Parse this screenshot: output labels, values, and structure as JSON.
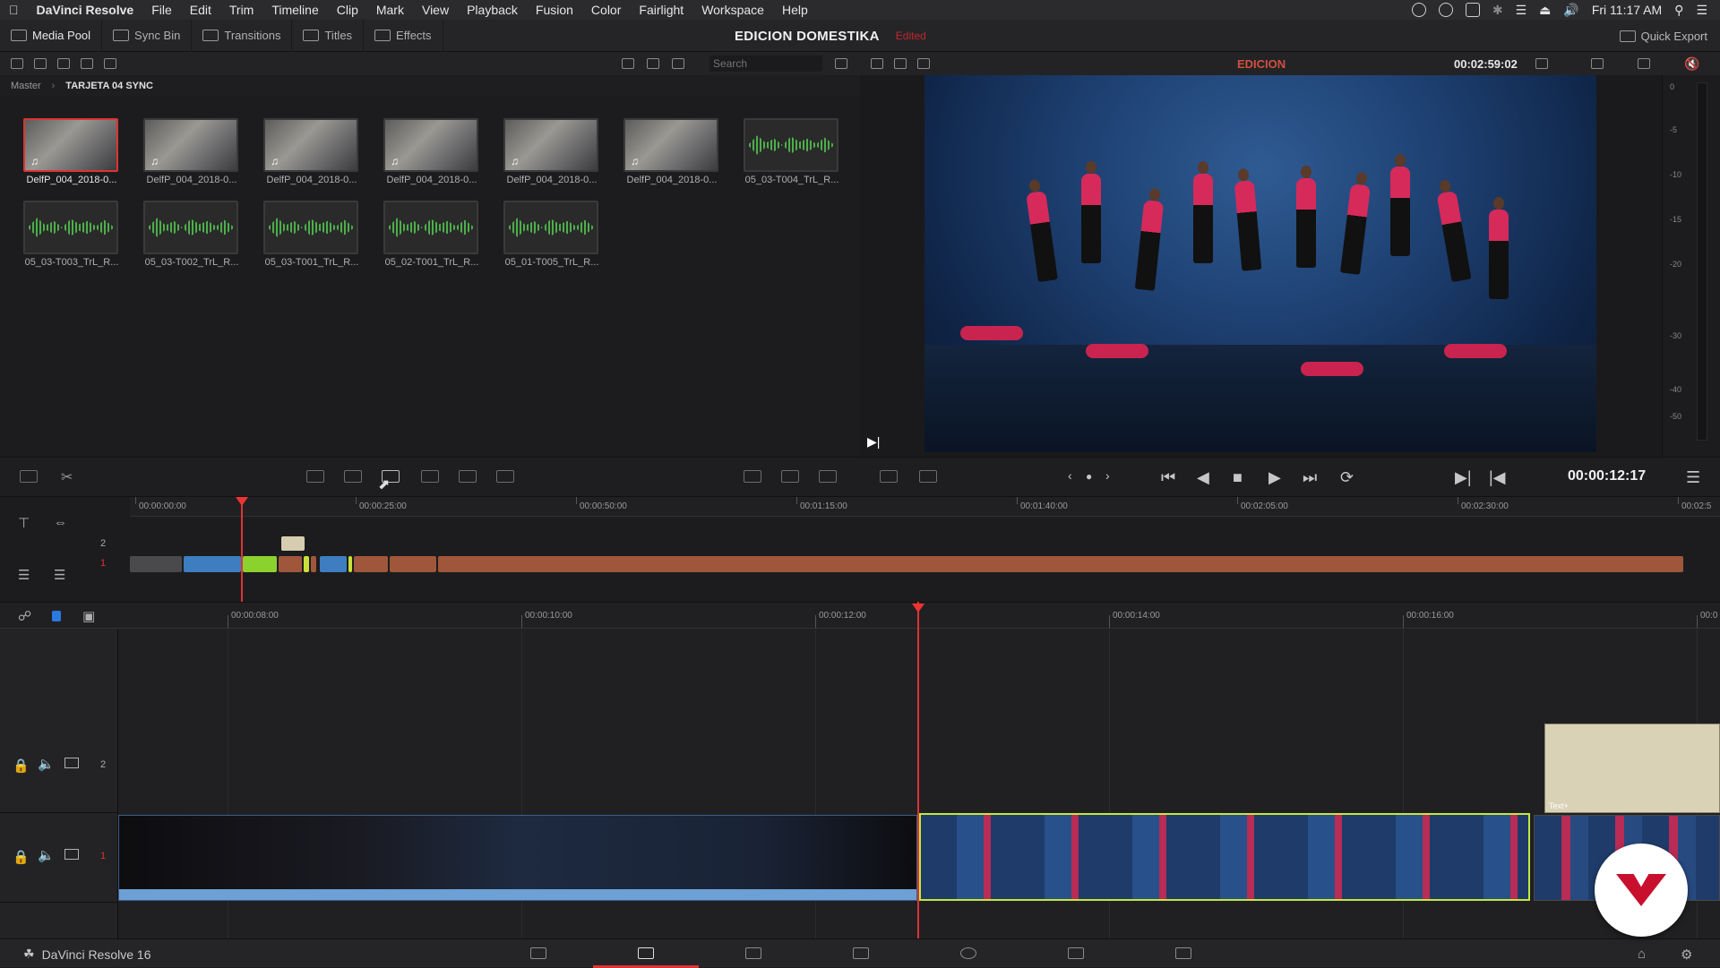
{
  "menubar": {
    "apple": "",
    "app_name": "DaVinci Resolve",
    "items": [
      "File",
      "Edit",
      "Trim",
      "Timeline",
      "Clip",
      "Mark",
      "View",
      "Playback",
      "Fusion",
      "Color",
      "Fairlight",
      "Workspace",
      "Help"
    ],
    "clock": "Fri 11:17 AM"
  },
  "toolbar": {
    "media_pool": "Media Pool",
    "sync_bin": "Sync Bin",
    "transitions": "Transitions",
    "titles": "Titles",
    "effects": "Effects",
    "project_name": "EDICION DOMESTIKA",
    "edited": "Edited",
    "quick_export": "Quick Export"
  },
  "pool": {
    "search_placeholder": "Search",
    "breadcrumb_root": "Master",
    "breadcrumb_bin": "TARJETA 04 SYNC",
    "clips": [
      {
        "label": "DelfP_004_2018-0...",
        "kind": "video",
        "selected": true
      },
      {
        "label": "DelfP_004_2018-0...",
        "kind": "video"
      },
      {
        "label": "DelfP_004_2018-0...",
        "kind": "video"
      },
      {
        "label": "DelfP_004_2018-0...",
        "kind": "video"
      },
      {
        "label": "DelfP_004_2018-0...",
        "kind": "video"
      },
      {
        "label": "DelfP_004_2018-0...",
        "kind": "video"
      },
      {
        "label": "05_03-T004_TrL_R...",
        "kind": "audio"
      },
      {
        "label": "05_03-T003_TrL_R...",
        "kind": "audio"
      },
      {
        "label": "05_03-T002_TrL_R...",
        "kind": "audio"
      },
      {
        "label": "05_03-T001_TrL_R...",
        "kind": "audio"
      },
      {
        "label": "05_02-T001_TrL_R...",
        "kind": "audio"
      },
      {
        "label": "05_01-T005_TrL_R...",
        "kind": "audio"
      }
    ]
  },
  "viewer": {
    "title": "EDICION",
    "source_timecode": "00:02:59:02",
    "meter_ticks": [
      "0",
      "-5",
      "-10",
      "-15",
      "-20",
      "-30",
      "-40",
      "-50"
    ]
  },
  "transport": {
    "timecode": "00:00:12:17"
  },
  "upper_timeline": {
    "ruler": [
      "00:00:00:00",
      "00:00:25:00",
      "00:00:50:00",
      "00:01:15:00",
      "00:01:40:00",
      "00:02:05:00",
      "00:02:30:00",
      "00:02:5"
    ],
    "track_numbers": [
      "2",
      "1"
    ]
  },
  "lower_timeline": {
    "ruler": [
      "00:00:08:00",
      "00:00:10:00",
      "00:00:12:00",
      "00:00:14:00",
      "00:00:16:00",
      "00:0"
    ],
    "track_numbers": [
      "2",
      "1"
    ],
    "text_clip_label": "Text+"
  },
  "footer": {
    "brand": "DaVinci Resolve 16"
  },
  "colors": {
    "accent_red": "#d33333",
    "selected_clip_border": "#c4e83a",
    "audio_wave": "#4caf4a"
  }
}
